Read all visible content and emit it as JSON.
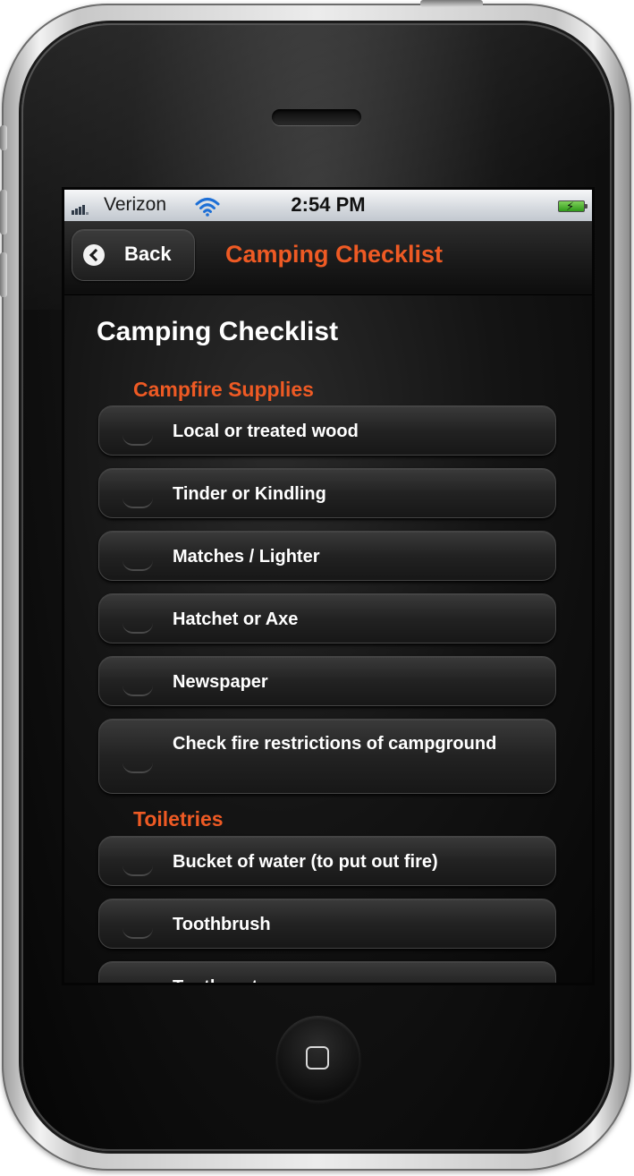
{
  "status_bar": {
    "carrier": "Verizon",
    "time": "2:54 PM",
    "signal_icon": "signal-bars-icon",
    "wifi_icon": "wifi-icon",
    "battery_icon": "battery-charging-icon"
  },
  "nav": {
    "back_label": "Back",
    "title": "Camping Checklist",
    "title_color": "#ee5a24"
  },
  "page": {
    "title": "Camping Checklist"
  },
  "sections": [
    {
      "header": "Campfire Supplies",
      "items": [
        "Local or treated wood",
        "Tinder or Kindling",
        "Matches / Lighter",
        "Hatchet or Axe",
        "Newspaper",
        "Check fire restrictions of campground"
      ]
    },
    {
      "header": "Toiletries",
      "items": [
        "Bucket of water (to put out fire)",
        "Toothbrush",
        "Toothpaste"
      ]
    }
  ]
}
